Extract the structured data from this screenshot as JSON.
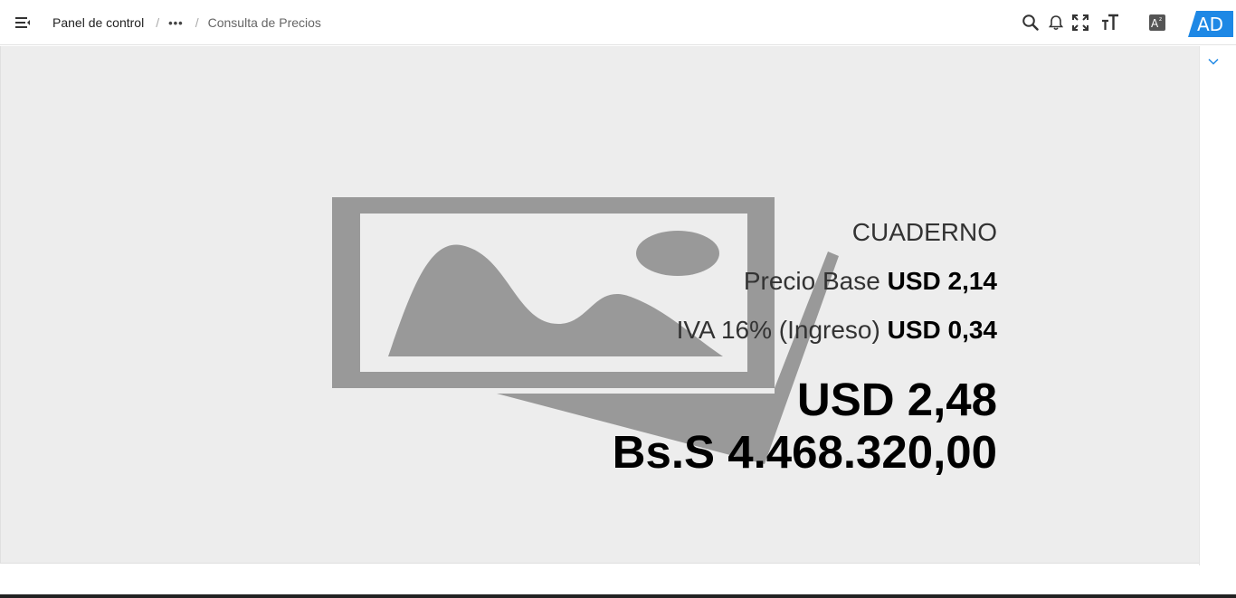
{
  "header": {
    "menu_icon": "menu-collapse-icon",
    "breadcrumb": {
      "home": "Panel de control",
      "separator": "/",
      "more": "•••",
      "current": "Consulta de Precios"
    },
    "icons": [
      "search-icon",
      "bell-icon",
      "fullscreen-icon",
      "text-size-icon",
      "translate-icon"
    ],
    "user_initials": "AD",
    "accent_color": "#1e88e5"
  },
  "product": {
    "name": "CUADERNO",
    "base_price_label": "Precio Base",
    "base_price_value": "USD 2,14",
    "tax_label": "IVA 16% (Ingreso)",
    "tax_value": "USD 0,34",
    "total_usd": "USD 2,48",
    "total_bs": "Bs.S 4.468.320,00",
    "image_icon": "image-placeholder-icon"
  },
  "side_panel": {
    "collapse_icon": "chevron-down-icon"
  }
}
